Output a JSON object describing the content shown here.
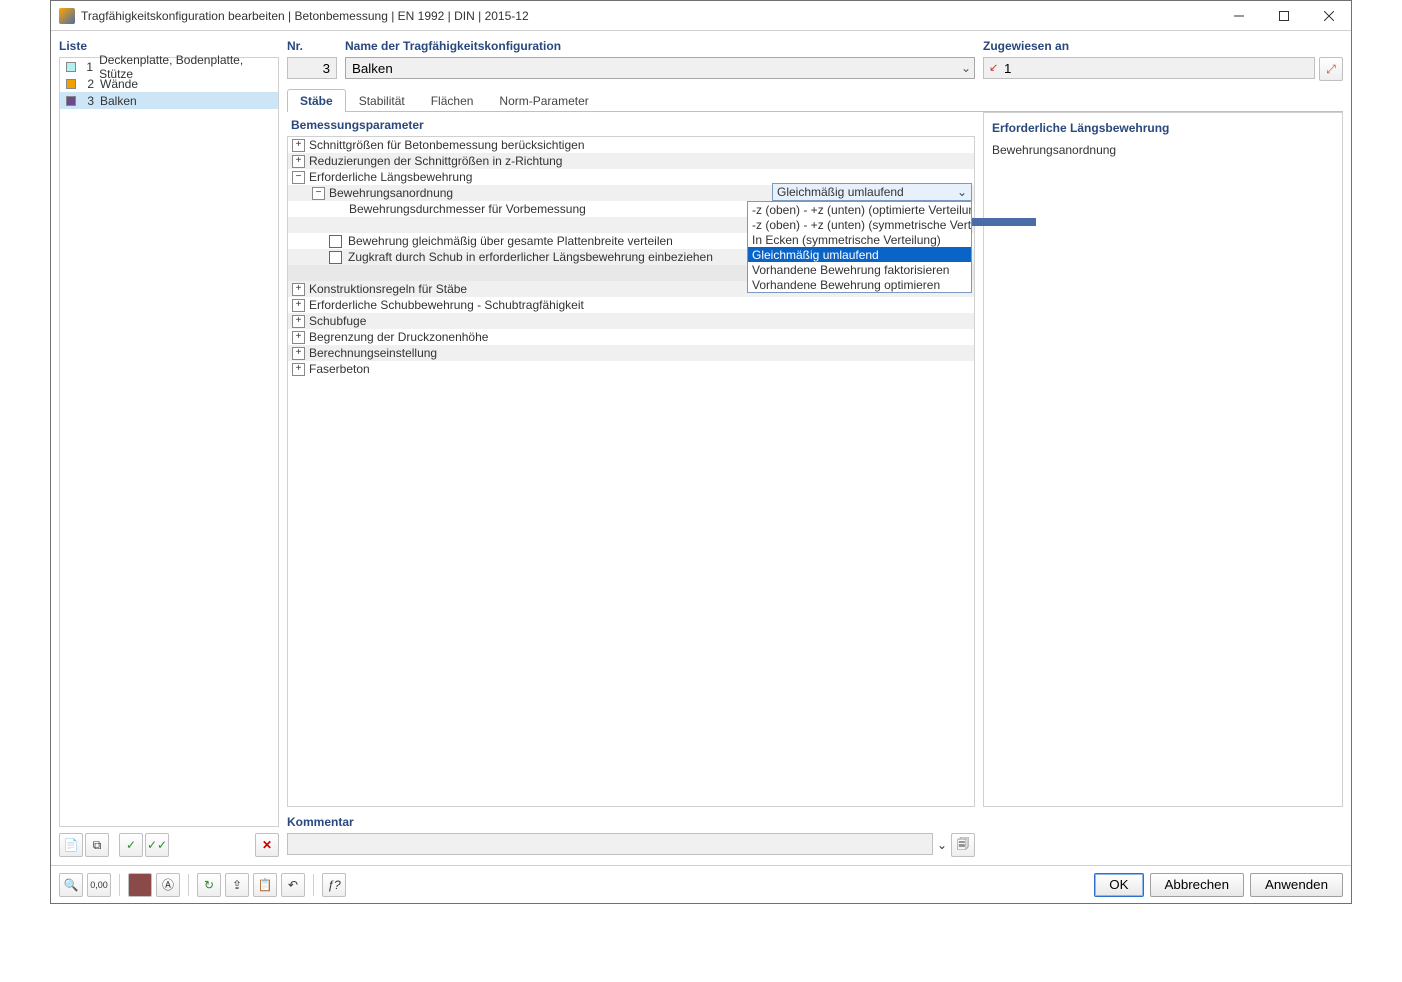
{
  "window_title": "Tragfähigkeitskonfiguration bearbeiten | Betonbemessung | EN 1992 | DIN | 2015-12",
  "left": {
    "header": "Liste",
    "items": [
      {
        "num": "1",
        "label": "Deckenplatte, Bodenplatte, Stütze",
        "color": "#b4f0f0"
      },
      {
        "num": "2",
        "label": "Wände",
        "color": "#f0a000"
      },
      {
        "num": "3",
        "label": "Balken",
        "color": "#6b4a8b"
      }
    ]
  },
  "top": {
    "nr_label": "Nr.",
    "nr_value": "3",
    "name_label": "Name der Tragfähigkeitskonfiguration",
    "name_value": "Balken",
    "assigned_label": "Zugewiesen an",
    "assigned_value": "1",
    "assigned_icon": "↗"
  },
  "tabs": {
    "items": [
      "Stäbe",
      "Stabilität",
      "Flächen",
      "Norm-Parameter"
    ],
    "active": 0
  },
  "params": {
    "header": "Bemessungsparameter",
    "rows": [
      {
        "indent": 0,
        "tw": "+",
        "label": "Schnittgrößen für Betonbemessung berücksichtigen",
        "alt": false
      },
      {
        "indent": 0,
        "tw": "+",
        "label": "Reduzierungen der Schnittgrößen in z-Richtung",
        "alt": true
      },
      {
        "indent": 0,
        "tw": "−",
        "label": "Erforderliche Längsbewehrung",
        "alt": false
      },
      {
        "indent": 1,
        "tw": "−",
        "label": "Bewehrungsanordnung",
        "alt": true,
        "hasCombo": true
      },
      {
        "indent": 2,
        "tw": "",
        "label": "Bewehrungsdurchmesser für Vorbemessung",
        "alt": false
      },
      {
        "indent": 1,
        "tw": "",
        "label": "",
        "alt": true
      },
      {
        "indent": 1,
        "tw": "",
        "cb": true,
        "label": "Bewehrung gleichmäßig über gesamte Plattenbreite verteilen",
        "alt": false
      },
      {
        "indent": 1,
        "tw": "",
        "cb": true,
        "label": "Zugkraft durch Schub in erforderlicher Längsbewehrung einbeziehen",
        "alt": true
      },
      {
        "indent": 0,
        "tw": "",
        "label": "",
        "alt": false,
        "bg2": true
      },
      {
        "indent": 0,
        "tw": "+",
        "label": "Konstruktionsregeln für Stäbe",
        "alt": true
      },
      {
        "indent": 0,
        "tw": "+",
        "label": "Erforderliche Schubbewehrung - Schubtragfähigkeit",
        "alt": false
      },
      {
        "indent": 0,
        "tw": "+",
        "label": "Schubfuge",
        "alt": true
      },
      {
        "indent": 0,
        "tw": "+",
        "label": "Begrenzung der Druckzonenhöhe",
        "alt": false
      },
      {
        "indent": 0,
        "tw": "+",
        "label": "Berechnungseinstellung",
        "alt": true
      },
      {
        "indent": 0,
        "tw": "+",
        "label": "Faserbeton",
        "alt": false
      }
    ],
    "combo_value": "Gleichmäßig umlaufend",
    "dropdown": [
      "-z (oben) - +z (unten) (optimierte Verteilung)",
      "-z (oben) - +z (unten) (symmetrische Verteilung)",
      "In Ecken (symmetrische Verteilung)",
      "Gleichmäßig umlaufend",
      "Vorhandene Bewehrung faktorisieren",
      "Vorhandene Bewehrung optimieren"
    ],
    "dropdown_selected": 3
  },
  "right_info": {
    "header": "Erforderliche Längsbewehrung",
    "text": "Bewehrungsanordnung"
  },
  "comment": {
    "label": "Kommentar",
    "value": ""
  },
  "footer": {
    "ok": "OK",
    "cancel": "Abbrechen",
    "apply": "Anwenden"
  },
  "icons": {
    "delete": "✕",
    "chev": "⌄"
  }
}
